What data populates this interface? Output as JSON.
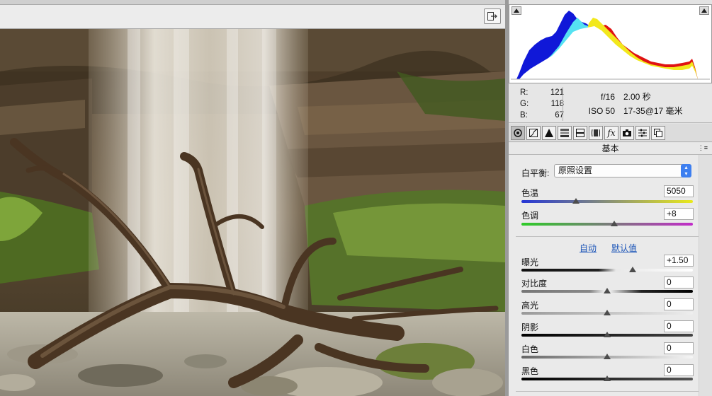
{
  "photo": {
    "description_icon": "waterfall-photo"
  },
  "toolbar": {
    "export_icon": "export-icon"
  },
  "histogram": {
    "clip_left_icon": "shadow-clip-warning-icon",
    "clip_right_icon": "highlight-clip-warning-icon"
  },
  "readout": {
    "r_label": "R:",
    "r_value": "121",
    "g_label": "G:",
    "g_value": "118",
    "b_label": "B:",
    "b_value": "67",
    "aperture": "f/16",
    "shutter": "2.00 秒",
    "iso": "ISO 50",
    "lens": "17-35@17 毫米"
  },
  "tabs": [
    {
      "icon": "basic-panel-icon"
    },
    {
      "icon": "tone-curve-icon"
    },
    {
      "icon": "detail-icon"
    },
    {
      "icon": "hsl-icon"
    },
    {
      "icon": "split-toning-icon"
    },
    {
      "icon": "lens-corrections-icon"
    },
    {
      "icon": "effects-icon",
      "glyph": "fx"
    },
    {
      "icon": "camera-calibration-icon"
    },
    {
      "icon": "presets-icon"
    },
    {
      "icon": "snapshots-icon"
    }
  ],
  "panel": {
    "title": "基本",
    "wb_label": "白平衡:",
    "wb_value": "原照设置",
    "temp_label": "色温",
    "temp_value": "5050",
    "temp_level": 0.32,
    "tint_label": "色调",
    "tint_value": "+8",
    "tint_level": 0.54,
    "auto_label": "自动",
    "default_label": "默认值",
    "exposure_label": "曝光",
    "exposure_value": "+1.50",
    "exposure_level": 0.65,
    "contrast_label": "对比度",
    "contrast_value": "0",
    "contrast_level": 0.5,
    "highlights_label": "高光",
    "highlights_value": "0",
    "highlights_level": 0.5,
    "shadows_label": "阴影",
    "shadows_value": "0",
    "shadows_level": 0.5,
    "whites_label": "白色",
    "whites_value": "0",
    "whites_level": 0.5,
    "blacks_label": "黑色",
    "blacks_value": "0",
    "blacks_level": 0.5
  },
  "colors": {
    "temp_gradient_start": "#2636d6",
    "temp_gradient_end": "#e9e91c",
    "tint_gradient_start": "#2ecc28",
    "tint_gradient_end": "#c22cc9",
    "link": "#1d56b8"
  }
}
